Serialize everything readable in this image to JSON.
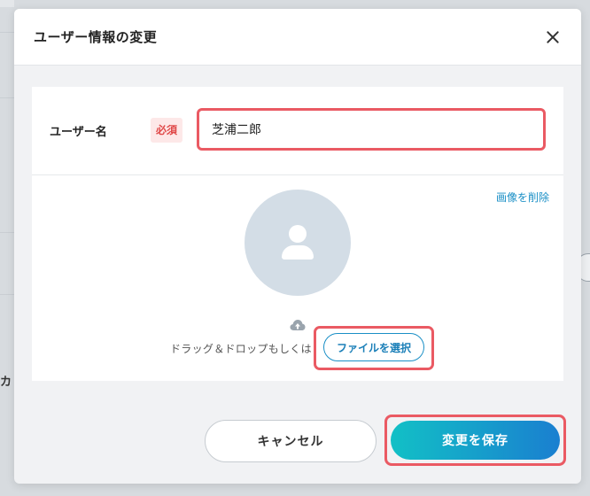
{
  "background": {
    "partial_label": "カ"
  },
  "modal": {
    "title": "ユーザー情報の変更",
    "close_icon": "close-icon"
  },
  "form": {
    "username_label": "ユーザー名",
    "required_badge": "必須",
    "username_value": "芝浦二郎"
  },
  "image": {
    "delete_link": "画像を削除",
    "avatar_icon": "user-placeholder-icon",
    "upload_icon": "cloud-upload-icon",
    "drop_text": "ドラッグ＆ドロップもしくは",
    "file_button": "ファイルを選択"
  },
  "footer": {
    "cancel_label": "キャンセル",
    "save_label": "変更を保存"
  },
  "colors": {
    "accent": "#1a8fc6",
    "highlight": "#ea5a63",
    "required": "#e04848",
    "save_gradient_start": "#12c0c6",
    "save_gradient_end": "#1a7fd0"
  }
}
